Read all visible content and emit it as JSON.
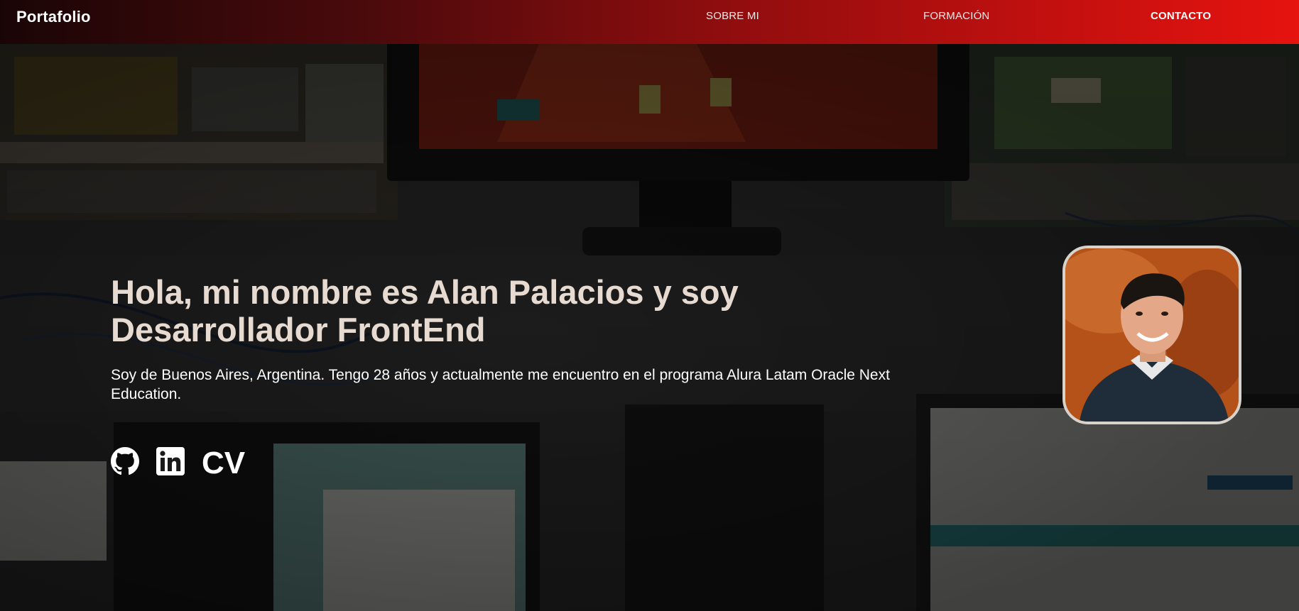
{
  "nav": {
    "brand": "Portafolio",
    "links": [
      {
        "label": "SOBRE MI"
      },
      {
        "label": "FORMACIÓN"
      },
      {
        "label": "CONTACTO"
      }
    ]
  },
  "hero": {
    "title": "Hola, mi nombre es Alan Palacios y soy Desarrollador FrontEnd",
    "description": "Soy de Buenos Aires, Argentina. Tengo 28 años y actualmente me encuentro en el programa Alura Latam Oracle Next Education.",
    "social": {
      "github_icon": "github-icon",
      "linkedin_icon": "linkedin-icon",
      "cv_label": "CV"
    }
  },
  "colors": {
    "nav_gradient_start": "#1a0506",
    "nav_gradient_end": "#e6130f",
    "title_color": "#e7dbd1"
  }
}
